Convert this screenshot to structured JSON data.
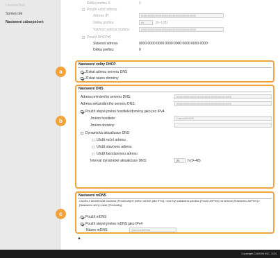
{
  "sidebar": {
    "items": [
      {
        "label": "Licence/Jiná"
      },
      {
        "label": "Správa dat"
      },
      {
        "label": "Nastavení zabezpečení"
      }
    ]
  },
  "ipv6": {
    "prefix_len_label": "Délka prefixu 6:",
    "prefix_len_value": "0",
    "manual_label": "Použít ruční adresu",
    "ip_label": "Adresa IP:",
    "ip_value": "0000:0000:0000:0000:0000:0000:0000:0000",
    "plen_label": "Délka prefixu:",
    "plen_value": "64",
    "plen_range": "(0–128)",
    "router_label": "Výchozí adresa routeru:",
    "router_value": "0000:0000:0000:0000:0000:0000:0000:0000",
    "dhcp_label": "Použít DHCPv6",
    "stateful_label": "Stavová adresa:",
    "stateful_value": "0000:0000:0000:0000:0000:0000:0000:0000",
    "stateful_plen_label": "Délka prefixu:",
    "stateful_plen_value": "0"
  },
  "dhcp": {
    "badge": "a",
    "title": "Nastavení volby DHCP",
    "dns_server_label": "Získat adresu serveru DNS",
    "domain_label": "Získat název domény"
  },
  "dns": {
    "badge": "b",
    "title": "Nastavení DNS",
    "primary_label": "Adresa primárního serveru DNS:",
    "primary_value": "0000:0000:0000:0000:0000:0000:0000:0000",
    "secondary_label": "Adresa sekundárního serveru DNS:",
    "secondary_value": "0000:0000:0000:0000:0000:0000:0000:0000",
    "same_host_label": "Použít stejné jméno hostitele/domény jako pro IPv4",
    "host_label": "Jméno hostitele:",
    "host_value": "Canon000000",
    "domain_label": "Jméno domény:",
    "domain_value": "",
    "dynamic_label": "Dynamická aktualizace DNS",
    "manual_addr_label": "Uložit ruční adresu",
    "stateful_addr_label": "Uložit stavovou adresu",
    "stateless_addr_label": "Uložit bezstavovou adresu",
    "interval_label": "Interval dynamické aktualizace DNS:",
    "interval_value": "24",
    "interval_unit": "h (0–48)"
  },
  "mdns": {
    "badge": "c",
    "title": "Nastavení mDNS",
    "notice": "Chcete-li deaktivovat možnost [Použít stejné jméno mDNS jako IPv4], musí být zakázána položka [Použít AirPrint] na stránce [Nastavení AirPrint] v [Nastavení sítě] v části [Předvolby].",
    "use_label": "Použít mDNS",
    "same_name_label": "Použít stejné jméno mDNS jako IPv4",
    "name_label": "Název mDNS:",
    "name_value": "Canon LBP000"
  },
  "up_arrow": "▲",
  "footer": {
    "copyright": "Copyright CANON INC. 2021"
  }
}
